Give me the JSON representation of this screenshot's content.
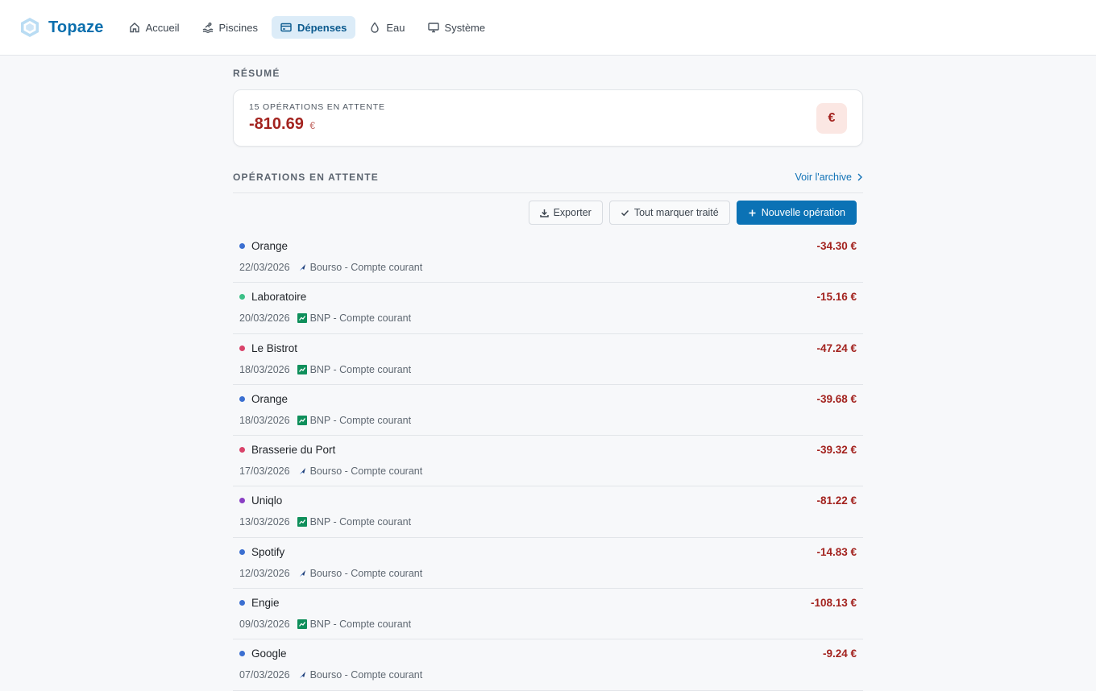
{
  "app": {
    "name": "Topaze",
    "brand_color": "#0b6fae"
  },
  "nav": [
    {
      "label": "Accueil",
      "icon": "home-icon",
      "active": false
    },
    {
      "label": "Piscines",
      "icon": "swimmer-icon",
      "active": false
    },
    {
      "label": "Dépenses",
      "icon": "credit-card-icon",
      "active": true
    },
    {
      "label": "Eau",
      "icon": "droplet-icon",
      "active": false
    },
    {
      "label": "Système",
      "icon": "monitor-icon",
      "active": false
    }
  ],
  "summary": {
    "section_title": "RÉSUMÉ",
    "pending_label": "15 OPÉRATIONS EN ATTENTE",
    "total": "-810.69",
    "currency": "€",
    "badge_symbol": "€"
  },
  "operations": {
    "section_title": "OPÉRATIONS EN ATTENTE",
    "archive_link": "Voir l'archive",
    "toolbar": {
      "export_label": "Exporter",
      "mark_all_label": "Tout marquer traité",
      "new_label": "Nouvelle opération"
    },
    "items": [
      {
        "name": "Orange",
        "date": "22/03/2026",
        "account": "Bourso - Compte courant",
        "bank": "bourso",
        "amount": "-34.30 €",
        "dot_color": "#3b6fd1"
      },
      {
        "name": "Laboratoire",
        "date": "20/03/2026",
        "account": "BNP - Compte courant",
        "bank": "bnp",
        "amount": "-15.16 €",
        "dot_color": "#3cc087"
      },
      {
        "name": "Le Bistrot",
        "date": "18/03/2026",
        "account": "BNP - Compte courant",
        "bank": "bnp",
        "amount": "-47.24 €",
        "dot_color": "#d9436a"
      },
      {
        "name": "Orange",
        "date": "18/03/2026",
        "account": "BNP - Compte courant",
        "bank": "bnp",
        "amount": "-39.68 €",
        "dot_color": "#3b6fd1"
      },
      {
        "name": "Brasserie du Port",
        "date": "17/03/2026",
        "account": "Bourso - Compte courant",
        "bank": "bourso",
        "amount": "-39.32 €",
        "dot_color": "#d9436a"
      },
      {
        "name": "Uniqlo",
        "date": "13/03/2026",
        "account": "BNP - Compte courant",
        "bank": "bnp",
        "amount": "-81.22 €",
        "dot_color": "#8a3fc4"
      },
      {
        "name": "Spotify",
        "date": "12/03/2026",
        "account": "Bourso - Compte courant",
        "bank": "bourso",
        "amount": "-14.83 €",
        "dot_color": "#3b6fd1"
      },
      {
        "name": "Engie",
        "date": "09/03/2026",
        "account": "BNP - Compte courant",
        "bank": "bnp",
        "amount": "-108.13 €",
        "dot_color": "#3b6fd1"
      },
      {
        "name": "Google",
        "date": "07/03/2026",
        "account": "Bourso - Compte courant",
        "bank": "bourso",
        "amount": "-9.24 €",
        "dot_color": "#3b6fd1"
      }
    ]
  }
}
